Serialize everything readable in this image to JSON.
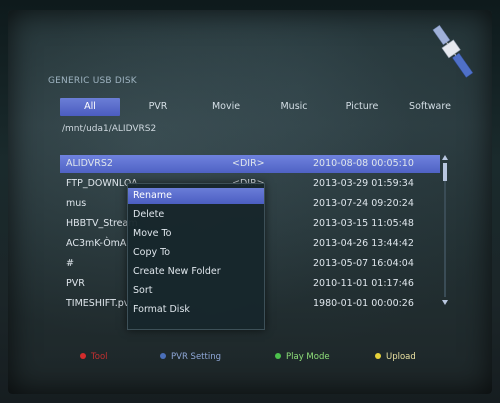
{
  "window": {
    "title": "GENERIC USB DISK"
  },
  "tabs": [
    {
      "label": "All",
      "active": true
    },
    {
      "label": "PVR",
      "active": false
    },
    {
      "label": "Movie",
      "active": false
    },
    {
      "label": "Music",
      "active": false
    },
    {
      "label": "Picture",
      "active": false
    },
    {
      "label": "Software",
      "active": false
    }
  ],
  "path": "/mnt/uda1/ALIDVRS2",
  "files": [
    {
      "name": "ALIDVRS2",
      "type": "<DIR>",
      "date": "2010-08-08 00:05:10",
      "selected": true
    },
    {
      "name": "FTP_DOWNLOA",
      "type": "<DIR>",
      "date": "2013-03-29 01:59:34",
      "selected": false
    },
    {
      "name": "mus",
      "type": "",
      "date": "2013-07-24 09:20:24",
      "selected": false
    },
    {
      "name": "HBBTV_Stream",
      "type": "",
      "date": "2013-03-15 11:05:48",
      "selected": false
    },
    {
      "name": "AC3mK-ÒmA",
      "type": "",
      "date": "2013-04-26 13:44:42",
      "selected": false
    },
    {
      "name": "#",
      "type": "",
      "date": "2013-05-07 16:04:04",
      "selected": false
    },
    {
      "name": "PVR",
      "type": "",
      "date": "2010-11-01 01:17:46",
      "selected": false
    },
    {
      "name": "TIMESHIFT.pvr",
      "type": "",
      "date": "1980-01-01 00:00:26",
      "selected": false
    }
  ],
  "context_menu": [
    {
      "label": "Rename",
      "selected": true
    },
    {
      "label": "Delete",
      "selected": false
    },
    {
      "label": "Move To",
      "selected": false
    },
    {
      "label": "Copy To",
      "selected": false
    },
    {
      "label": "Create New Folder",
      "selected": false
    },
    {
      "label": "Sort",
      "selected": false
    },
    {
      "label": "Format Disk",
      "selected": false
    }
  ],
  "footer": [
    {
      "label": "Tool",
      "color": "#d32c2c",
      "text_color": "#c23030"
    },
    {
      "label": "PVR Setting",
      "color": "#4a6fb8",
      "text_color": "#8fa8d8"
    },
    {
      "label": "Play Mode",
      "color": "#4cc24c",
      "text_color": "#8fe07a"
    },
    {
      "label": "Upload",
      "color": "#e6d23a",
      "text_color": "#e8e0a0"
    }
  ],
  "colors": {
    "highlight": "#5a6ed0",
    "scrollbar": "#b9c7e0"
  },
  "icons": {
    "logo": "satellite-icon"
  }
}
